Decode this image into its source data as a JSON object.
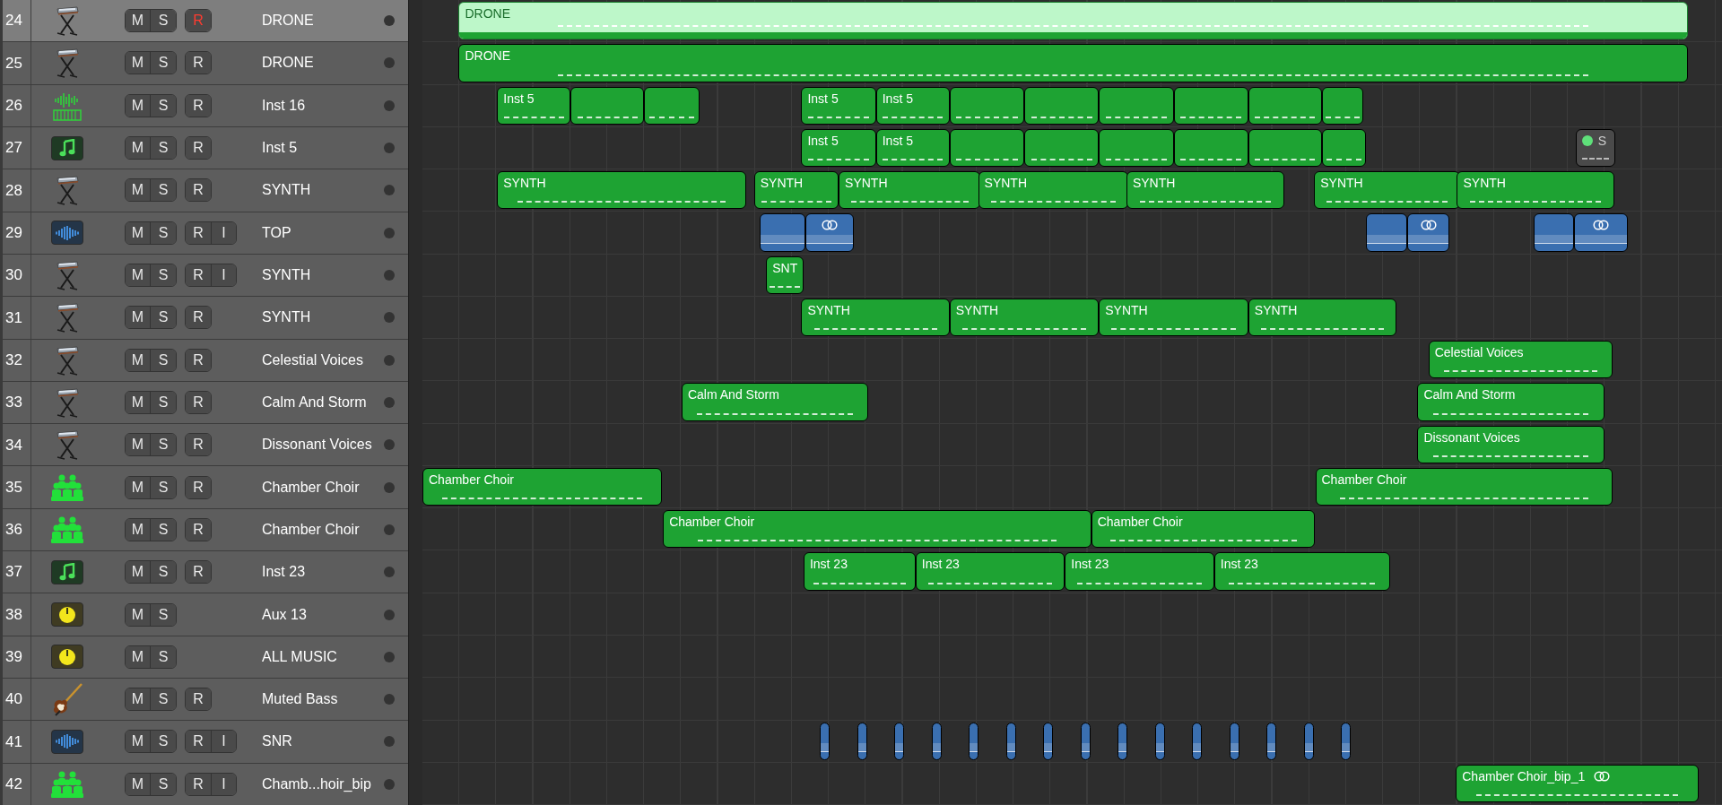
{
  "tracks": [
    {
      "number": "24",
      "name": "DRONE",
      "kind": "keyboard",
      "selected": true,
      "mute": "M",
      "solo": "S",
      "record": {
        "label": "R",
        "armed": true
      },
      "regions": [
        {
          "kind": "midi",
          "name": "DRONE",
          "selected": true
        }
      ]
    },
    {
      "number": "25",
      "name": "DRONE",
      "kind": "keyboard",
      "selected": false,
      "mute": "M",
      "solo": "S",
      "record": {
        "label": "R",
        "armed": false
      },
      "regions": [
        {
          "kind": "midi",
          "name": "DRONE",
          "selected": false
        }
      ]
    },
    {
      "number": "26",
      "name": "Inst 16",
      "kind": "instrument",
      "selected": false,
      "mute": "M",
      "solo": "S",
      "record": {
        "label": "R",
        "armed": false
      },
      "regions": [
        {
          "kind": "midi",
          "name": "Inst 5",
          "selected": false
        },
        {
          "kind": "midi",
          "selected": false
        },
        {
          "kind": "midi",
          "selected": false
        },
        {
          "kind": "midi",
          "name": "Inst 5",
          "selected": false
        },
        {
          "kind": "midi",
          "name": "Inst 5",
          "selected": false
        },
        {
          "kind": "midi",
          "selected": false
        },
        {
          "kind": "midi",
          "selected": false
        },
        {
          "kind": "midi",
          "selected": false
        },
        {
          "kind": "midi",
          "selected": false
        },
        {
          "kind": "midi",
          "selected": false
        },
        {
          "kind": "midi",
          "selected": false
        }
      ]
    },
    {
      "number": "27",
      "name": "Inst 5",
      "kind": "midi",
      "selected": false,
      "mute": "M",
      "solo": "S",
      "record": {
        "label": "R",
        "armed": false
      },
      "regions": [
        {
          "kind": "midi",
          "name": "Inst 5",
          "selected": false
        },
        {
          "kind": "midi",
          "name": "Inst 5",
          "selected": false
        },
        {
          "kind": "midi",
          "selected": false
        },
        {
          "kind": "midi",
          "selected": false
        },
        {
          "kind": "midi",
          "selected": false
        },
        {
          "kind": "midi",
          "selected": false
        },
        {
          "kind": "midi",
          "selected": false
        },
        {
          "kind": "midi",
          "selected": false
        },
        {
          "kind": "muted",
          "name": "S",
          "selected": false
        }
      ]
    },
    {
      "number": "28",
      "name": "SYNTH",
      "kind": "keyboard",
      "selected": false,
      "mute": "M",
      "solo": "S",
      "record": {
        "label": "R",
        "armed": false
      },
      "regions": [
        {
          "kind": "midi",
          "name": "SYNTH",
          "selected": false
        },
        {
          "kind": "midi",
          "name": "SYNTH",
          "selected": false
        },
        {
          "kind": "midi",
          "name": "SYNTH",
          "selected": false
        },
        {
          "kind": "midi",
          "name": "SYNTH",
          "selected": false
        },
        {
          "kind": "midi",
          "name": "SYNTH",
          "selected": false
        },
        {
          "kind": "midi",
          "name": "SYNTH",
          "selected": false
        },
        {
          "kind": "midi",
          "name": "SYNTH",
          "selected": false
        }
      ]
    },
    {
      "number": "29",
      "name": "TOP",
      "kind": "audio",
      "selected": false,
      "mute": "M",
      "solo": "S",
      "record": {
        "label": "R",
        "armed": false
      },
      "input": "I",
      "regions": [
        {
          "kind": "audio",
          "looped": false,
          "selected": false
        },
        {
          "kind": "audio",
          "looped": true,
          "selected": false
        },
        {
          "kind": "audio",
          "looped": false,
          "selected": false
        },
        {
          "kind": "audio",
          "looped": true,
          "selected": false
        },
        {
          "kind": "audio",
          "looped": false,
          "selected": false
        },
        {
          "kind": "audio",
          "looped": true,
          "selected": false
        }
      ]
    },
    {
      "number": "30",
      "name": "SYNTH",
      "kind": "keyboard",
      "selected": false,
      "mute": "M",
      "solo": "S",
      "record": {
        "label": "R",
        "armed": false
      },
      "input": "I",
      "regions": [
        {
          "kind": "midi",
          "name": "SNT",
          "selected": false
        }
      ]
    },
    {
      "number": "31",
      "name": "SYNTH",
      "kind": "keyboard",
      "selected": false,
      "mute": "M",
      "solo": "S",
      "record": {
        "label": "R",
        "armed": false
      },
      "regions": [
        {
          "kind": "midi",
          "name": "SYNTH",
          "selected": false
        },
        {
          "kind": "midi",
          "name": "SYNTH",
          "selected": false
        },
        {
          "kind": "midi",
          "name": "SYNTH",
          "selected": false
        },
        {
          "kind": "midi",
          "name": "SYNTH",
          "selected": false
        }
      ]
    },
    {
      "number": "32",
      "name": "Celestial Voices",
      "kind": "keyboard",
      "selected": false,
      "mute": "M",
      "solo": "S",
      "record": {
        "label": "R",
        "armed": false
      },
      "regions": [
        {
          "kind": "midi",
          "name": "Celestial Voices",
          "selected": false
        }
      ]
    },
    {
      "number": "33",
      "name": "Calm And Storm",
      "kind": "keyboard",
      "selected": false,
      "mute": "M",
      "solo": "S",
      "record": {
        "label": "R",
        "armed": false
      },
      "regions": [
        {
          "kind": "midi",
          "name": "Calm And Storm",
          "selected": false
        },
        {
          "kind": "midi",
          "name": "Calm And Storm",
          "selected": false
        }
      ]
    },
    {
      "number": "34",
      "name": "Dissonant Voices",
      "kind": "keyboard",
      "selected": false,
      "mute": "M",
      "solo": "S",
      "record": {
        "label": "R",
        "armed": false
      },
      "regions": [
        {
          "kind": "midi",
          "name": "Dissonant Voices",
          "selected": false
        }
      ]
    },
    {
      "number": "35",
      "name": "Chamber Choir",
      "kind": "choir",
      "selected": false,
      "mute": "M",
      "solo": "S",
      "record": {
        "label": "R",
        "armed": false
      },
      "regions": [
        {
          "kind": "midi",
          "name": "Chamber Choir",
          "selected": false
        },
        {
          "kind": "midi",
          "name": "Chamber Choir",
          "selected": false
        }
      ]
    },
    {
      "number": "36",
      "name": "Chamber Choir",
      "kind": "choir",
      "selected": false,
      "mute": "M",
      "solo": "S",
      "record": {
        "label": "R",
        "armed": false
      },
      "regions": [
        {
          "kind": "midi",
          "name": "Chamber Choir",
          "selected": false
        },
        {
          "kind": "midi",
          "name": "Chamber Choir",
          "selected": false
        }
      ]
    },
    {
      "number": "37",
      "name": "Inst 23",
      "kind": "midi",
      "selected": false,
      "mute": "M",
      "solo": "S",
      "record": {
        "label": "R",
        "armed": false
      },
      "regions": [
        {
          "kind": "midi",
          "name": "Inst 23",
          "selected": false
        },
        {
          "kind": "midi",
          "name": "Inst 23",
          "selected": false
        },
        {
          "kind": "midi",
          "name": "Inst 23",
          "selected": false
        },
        {
          "kind": "midi",
          "name": "Inst 23",
          "selected": false
        }
      ]
    },
    {
      "number": "38",
      "name": "Aux 13",
      "kind": "aux",
      "selected": false,
      "mute": "M",
      "solo": "S"
    },
    {
      "number": "39",
      "name": "ALL MUSIC",
      "kind": "aux",
      "selected": false,
      "mute": "M",
      "solo": "S"
    },
    {
      "number": "40",
      "name": "Muted Bass",
      "kind": "bass",
      "selected": false,
      "mute": "M",
      "solo": "S",
      "record": {
        "label": "R",
        "armed": false
      }
    },
    {
      "number": "41",
      "name": "SNR",
      "kind": "audio",
      "selected": false,
      "mute": "M",
      "solo": "S",
      "record": {
        "label": "R",
        "armed": false
      },
      "input": "I",
      "regions": [
        {
          "kind": "audio",
          "selected": false
        },
        {
          "kind": "audio",
          "selected": false
        },
        {
          "kind": "audio",
          "selected": false
        },
        {
          "kind": "audio",
          "selected": false
        },
        {
          "kind": "audio",
          "selected": false
        },
        {
          "kind": "audio",
          "selected": false
        },
        {
          "kind": "audio",
          "selected": false
        },
        {
          "kind": "audio",
          "selected": false
        },
        {
          "kind": "audio",
          "selected": false
        },
        {
          "kind": "audio",
          "selected": false
        },
        {
          "kind": "audio",
          "selected": false
        },
        {
          "kind": "audio",
          "selected": false
        },
        {
          "kind": "audio",
          "selected": false
        },
        {
          "kind": "audio",
          "selected": false
        },
        {
          "kind": "audio",
          "selected": false
        }
      ]
    },
    {
      "number": "42",
      "name": "Chamb...hoir_bip",
      "kind": "choir",
      "selected": false,
      "mute": "M",
      "solo": "S",
      "record": {
        "label": "R",
        "armed": false
      },
      "input": "I",
      "regions": [
        {
          "kind": "midi",
          "name": "Chamber Choir_bip_1",
          "looped": true,
          "selected": false
        }
      ]
    }
  ]
}
